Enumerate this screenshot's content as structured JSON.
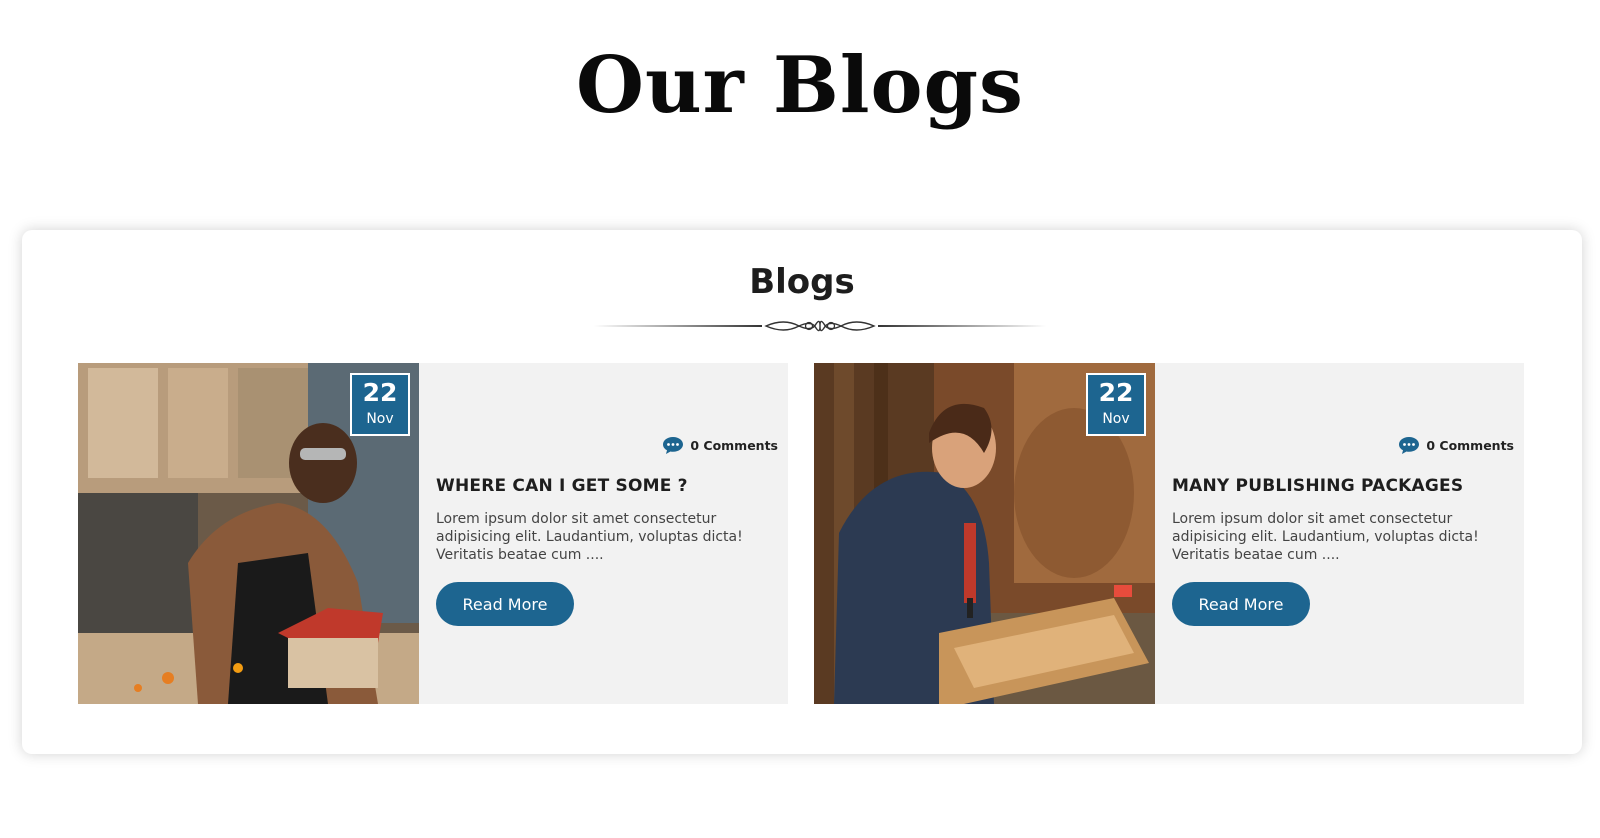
{
  "page": {
    "heading": "Our Blogs"
  },
  "section": {
    "title": "Blogs"
  },
  "colors": {
    "accent": "#1d6590",
    "card_bg": "#f2f2f2"
  },
  "posts": [
    {
      "day": "22",
      "month": "Nov",
      "comments": "0 Comments",
      "title": "WHERE CAN I GET SOME ?",
      "excerpt": "Lorem ipsum dolor sit amet consectetur adipisicing elit. Laudantium, voluptas dicta! Veritatis beatae cum ....",
      "button": "Read More",
      "image_icon": "carpenter-man-photo"
    },
    {
      "day": "22",
      "month": "Nov",
      "comments": "0 Comments",
      "title": "MANY PUBLISHING PACKAGES",
      "excerpt": "Lorem ipsum dolor sit amet consectetur adipisicing elit. Laudantium, voluptas dicta! Veritatis beatae cum ....",
      "button": "Read More",
      "image_icon": "carpenter-woman-photo"
    }
  ]
}
